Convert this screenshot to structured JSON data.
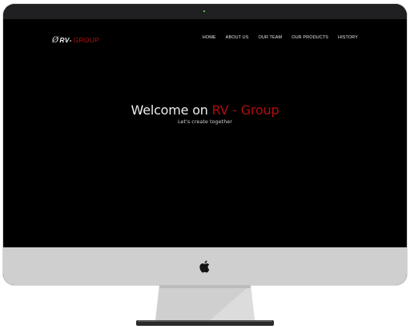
{
  "site": {
    "logo": {
      "mark": "Ø",
      "name": "RV",
      "separator": " -",
      "suffix": "GROUP"
    },
    "nav": [
      {
        "label": "HOME"
      },
      {
        "label": "ABOUT US"
      },
      {
        "label": "OUR TEAM"
      },
      {
        "label": "OUR PRODUCTS"
      },
      {
        "label": "HISTORY"
      }
    ],
    "hero": {
      "title_prefix": "Welcome on ",
      "title_accent": "RV - Group",
      "subtitle": "Let's create together"
    }
  },
  "colors": {
    "accent": "#b00c0c",
    "screen_bg": "#000000",
    "bezel": "#1c1c1e",
    "chin": "#cfcfcf"
  },
  "icons": {
    "camera": "webcam-icon",
    "brand": "apple-logo-icon"
  }
}
